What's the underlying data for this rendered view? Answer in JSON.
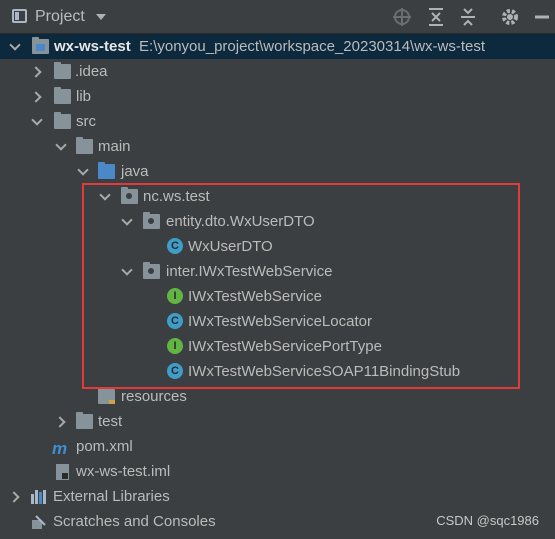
{
  "toolbar": {
    "title": "Project",
    "icons": [
      "project-view-icon",
      "dropdown-caret-icon",
      "locate-icon",
      "expand-all-icon",
      "collapse-all-icon",
      "gear-icon",
      "hide-icon"
    ]
  },
  "tree": {
    "root": {
      "name": "wx-ws-test",
      "path": "E:\\yonyou_project\\workspace_20230314\\wx-ws-test"
    },
    "idea": ".idea",
    "lib": "lib",
    "src": "src",
    "main": "main",
    "java": "java",
    "pkg_root": "nc.ws.test",
    "pkg_dto": "entity.dto.WxUserDTO",
    "cls_dto": "WxUserDTO",
    "pkg_inter": "inter.IWxTestWebService",
    "cls_svc": "IWxTestWebService",
    "cls_locator": "IWxTestWebServiceLocator",
    "cls_porttype": "IWxTestWebServicePortType",
    "cls_stub": "IWxTestWebServiceSOAP11BindingStub",
    "resources": "resources",
    "test": "test",
    "pom": "pom.xml",
    "iml": "wx-ws-test.iml",
    "ext_libs": "External Libraries",
    "scratches": "Scratches and Consoles"
  },
  "colors": {
    "selection": "#0d293e",
    "highlight_box": "#e03a3a",
    "class_icon": "#3e9dc9",
    "interface_icon": "#62b543"
  },
  "watermark": "CSDN @sqc1986"
}
